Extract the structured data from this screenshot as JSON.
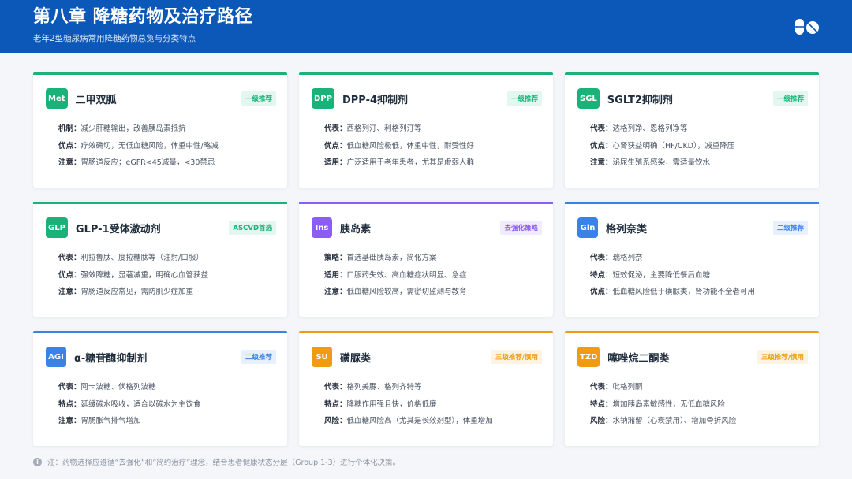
{
  "header": {
    "title": "第八章 降糖药物及治疗路径",
    "subtitle": "老年2型糖尿病常用降糖药物总览与分类特点",
    "icon": "pill-icon"
  },
  "cards": [
    {
      "abbr": "Met",
      "title": "二甲双胍",
      "badge": "一级推荐",
      "color": "#19b37a",
      "rows": [
        {
          "k": "机制：",
          "v": "减少肝糖输出，改善胰岛素抵抗"
        },
        {
          "k": "优点：",
          "v": "疗效确切，无低血糖风险，体重中性/略减"
        },
        {
          "k": "注意：",
          "v": "胃肠道反应；eGFR<45减量，<30禁忌"
        }
      ]
    },
    {
      "abbr": "DPP",
      "title": "DPP-4抑制剂",
      "badge": "一级推荐",
      "color": "#19b37a",
      "rows": [
        {
          "k": "代表：",
          "v": "西格列汀、利格列汀等"
        },
        {
          "k": "优点：",
          "v": "低血糖风险极低，体重中性，耐受性好"
        },
        {
          "k": "适用：",
          "v": "广泛适用于老年患者，尤其是虚弱人群"
        }
      ]
    },
    {
      "abbr": "SGL",
      "title": "SGLT2抑制剂",
      "badge": "一级推荐",
      "color": "#19b37a",
      "rows": [
        {
          "k": "代表：",
          "v": "达格列净、恩格列净等"
        },
        {
          "k": "优点：",
          "v": "心肾获益明确（HF/CKD），减重降压"
        },
        {
          "k": "注意：",
          "v": "泌尿生殖系感染，需适量饮水"
        }
      ]
    },
    {
      "abbr": "GLP",
      "title": "GLP-1受体激动剂",
      "badge": "ASCVD首选",
      "color": "#19b37a",
      "rows": [
        {
          "k": "代表：",
          "v": "利拉鲁肽、度拉糖肽等（注射/口服）"
        },
        {
          "k": "优点：",
          "v": "强效降糖，显著减重，明确心血管获益"
        },
        {
          "k": "注意：",
          "v": "胃肠道反应常见，需防肌少症加重"
        }
      ]
    },
    {
      "abbr": "Ins",
      "title": "胰岛素",
      "badge": "去强化策略",
      "color": "#8b5cf6",
      "rows": [
        {
          "k": "策略：",
          "v": "首选基础胰岛素，简化方案"
        },
        {
          "k": "适用：",
          "v": "口服药失效、高血糖症状明显、急症"
        },
        {
          "k": "注意：",
          "v": "低血糖风险较高，需密切监测与教育"
        }
      ]
    },
    {
      "abbr": "Gln",
      "title": "格列奈类",
      "badge": "二级推荐",
      "color": "#3b82e6",
      "rows": [
        {
          "k": "代表：",
          "v": "瑞格列奈"
        },
        {
          "k": "特点：",
          "v": "短效促泌，主要降低餐后血糖"
        },
        {
          "k": "优点：",
          "v": "低血糖风险低于磺脲类，肾功能不全者可用"
        }
      ]
    },
    {
      "abbr": "AGI",
      "title": "α-糖苷酶抑制剂",
      "badge": "二级推荐",
      "color": "#3b82e6",
      "rows": [
        {
          "k": "代表：",
          "v": "阿卡波糖、伏格列波糖"
        },
        {
          "k": "特点：",
          "v": "延缓碳水吸收，适合以碳水为主饮食"
        },
        {
          "k": "注意：",
          "v": "胃肠胀气排气增加"
        }
      ]
    },
    {
      "abbr": "SU",
      "title": "磺脲类",
      "badge": "三级推荐/慎用",
      "color": "#f29a12",
      "rows": [
        {
          "k": "代表：",
          "v": "格列美脲、格列齐特等"
        },
        {
          "k": "特点：",
          "v": "降糖作用强且快，价格低廉"
        },
        {
          "k": "风险：",
          "v": "低血糖风险高（尤其是长效剂型），体重增加"
        }
      ]
    },
    {
      "abbr": "TZD",
      "title": "噻唑烷二酮类",
      "badge": "三级推荐/慎用",
      "color": "#f29a12",
      "rows": [
        {
          "k": "代表：",
          "v": "吡格列酮"
        },
        {
          "k": "特点：",
          "v": "增加胰岛素敏感性，无低血糖风险"
        },
        {
          "k": "风险：",
          "v": "水钠潴留（心衰禁用）、增加骨折风险"
        }
      ]
    }
  ],
  "footer": {
    "note": "注：药物选择应遵循“去强化”和“简约治疗”理念，结合患者健康状态分层（Group 1-3）进行个体化决策。",
    "icon": "info-icon"
  }
}
